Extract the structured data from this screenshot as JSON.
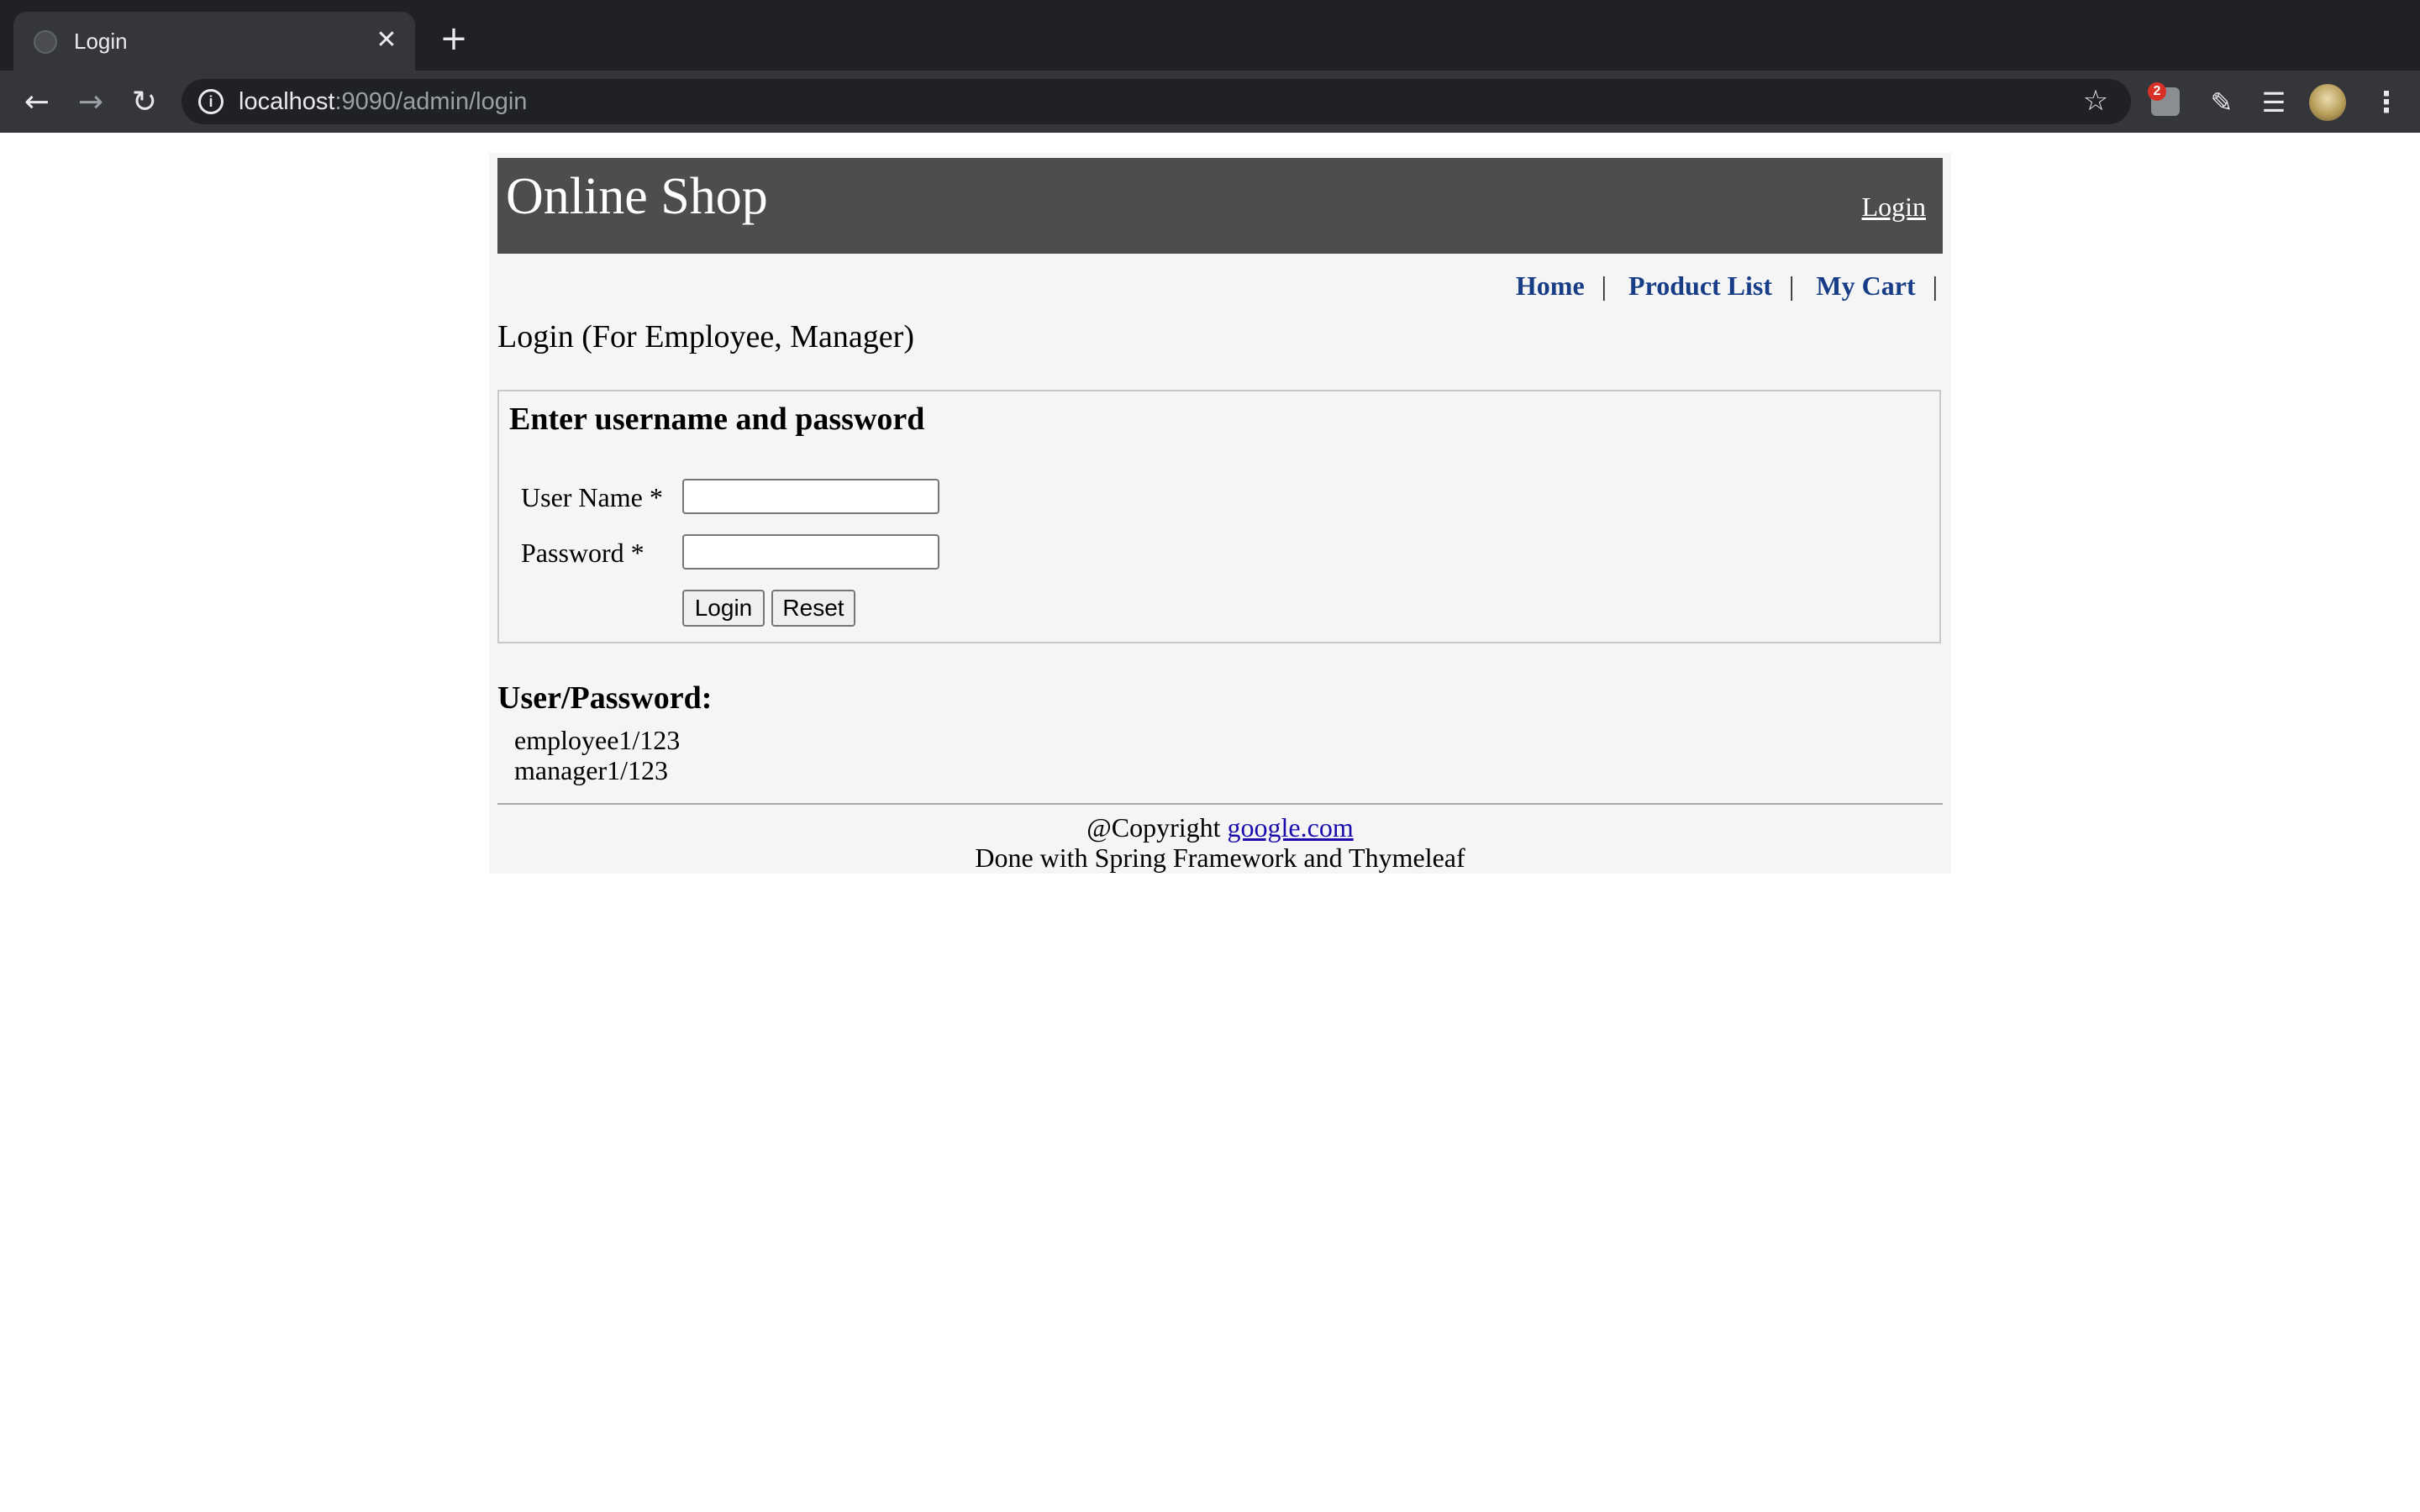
{
  "browser": {
    "tab_title": "Login",
    "tab_close": "✕",
    "new_tab": "+",
    "url_host": "localhost",
    "url_path": ":9090/admin/login",
    "ext_badge_count": "2"
  },
  "header": {
    "site_title": "Online Shop",
    "login_link": "Login"
  },
  "menu": {
    "items": [
      {
        "label": "Home"
      },
      {
        "label": "Product List"
      },
      {
        "label": "My Cart"
      }
    ],
    "separator": "|"
  },
  "page": {
    "title": "Login (For Employee, Manager)"
  },
  "form": {
    "heading": "Enter username and password",
    "username_label": "User Name *",
    "username_value": "",
    "password_label": "Password *",
    "password_value": "",
    "login_button": "Login",
    "reset_button": "Reset"
  },
  "credentials": {
    "title": "User/Password:",
    "lines": [
      "employee1/123",
      "manager1/123"
    ]
  },
  "footer": {
    "copyright_prefix": "@Copyright",
    "copyright_link": "google.com",
    "line2": "Done with Spring Framework and Thymeleaf"
  },
  "icons": {
    "favicon": "globe-icon",
    "back": "arrow-left-icon",
    "forward": "arrow-right-icon",
    "reload": "reload-icon",
    "info": "info-icon",
    "bookmark": "star-icon",
    "extensions": "puzzle-icon",
    "media": "playlist-icon",
    "profile": "avatar",
    "menu": "more-vert-icon"
  },
  "colors": {
    "banner": "#4d4d4d",
    "page_bg": "#f5f5f5",
    "menu_link": "#173d87",
    "footer_link": "#1a0dab",
    "chrome_dark": "#202124",
    "chrome_toolbar": "#35363a"
  }
}
